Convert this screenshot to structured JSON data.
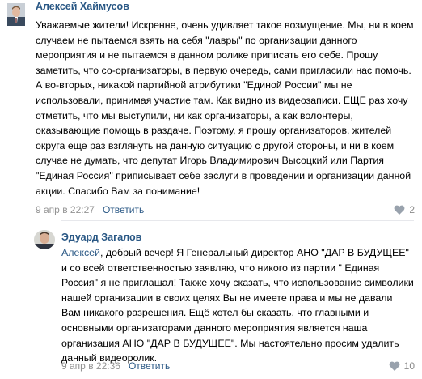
{
  "comments": [
    {
      "author": "Алексей Хаймусов",
      "text": "Уважаемые жители! Искренне, очень удивляет такое возмущение. Мы, ни в коем случаем не пытаемся взять на себя \"лавры\" по организации данного мероприятия и не пытаемся в данном ролике приписать его себе. Прошу заметить, что со-организаторы, в первую очередь, сами пригласили нас помочь. А во-вторых, никакой партийной атрибутики \"Единой России\" мы не использовали, принимая участие там. Как видно из видеозаписи. ЕЩЕ раз хочу отметить, что мы выступили, ни как организаторы, а как волонтеры, оказывающие помощь в раздаче. Поэтому, я прошу организаторов, жителей округа еще раз взглянуть на данную ситуацию с другой стороны, и ни в коем случае не думать, что депутат Игорь Владимирович Высоцкий или Партия \"Единая Россия\" приписывает себе заслуги в проведении и организации данной акции. Спасибо Вам за понимание!",
      "date": "9 апр в 22:27",
      "reply_label": "Ответить",
      "likes": "2",
      "like_icon": "heart-icon"
    },
    {
      "author": "Эдуард Загалов",
      "reply_to": "Алексей",
      "text": ", добрый вечер! Я Генеральный директор АНО \"ДАР В БУДУЩЕЕ\" и со всей ответственностью заявляю, что никого из партии \" Единая Россия\" я не приглашал! Также хочу сказать, что использование символики нашей организации в своих целях Вы не имеете права и мы не давали Вам никакого разрешения. Ещё хотел бы сказать, что главными и основными организаторами данного мероприятия является наша организация АНО \"ДАР В БУДУЩЕЕ\". Мы настоятельно просим удалить данный видеоролик.",
      "date": "9 апр в 22:36",
      "reply_label": "Ответить",
      "likes": "10",
      "like_icon": "heart-icon"
    }
  ],
  "colors": {
    "link": "#2a5885",
    "meta": "#939393",
    "divider": "#e7e8ec"
  }
}
